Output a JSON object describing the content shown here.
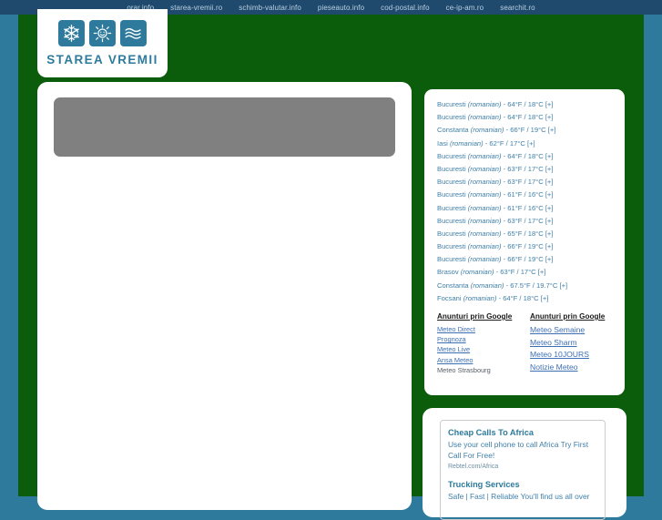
{
  "topnav": {
    "links": [
      {
        "label": "orar.info"
      },
      {
        "label": "starea-vremii.ro"
      },
      {
        "label": "schimb-valutar.info"
      },
      {
        "label": "pieseauto.info"
      },
      {
        "label": "cod-postal.info"
      },
      {
        "label": "ce-ip-am.ro"
      },
      {
        "label": "searchit.ro"
      }
    ]
  },
  "logo": {
    "text": "STAREA VREMII",
    "icons": [
      "snowflake-icon",
      "sun-icon",
      "waves-icon"
    ]
  },
  "weather": {
    "rows": [
      {
        "city": "Bucuresti",
        "lang": "(romanian)",
        "temp": "- 64°F / 18°C",
        "expand": "[+]"
      },
      {
        "city": "Bucuresti",
        "lang": "(romanian)",
        "temp": "- 64°F / 18°C",
        "expand": "[+]"
      },
      {
        "city": "Constanta",
        "lang": "(romanian)",
        "temp": "- 66°F / 19°C",
        "expand": "[+]"
      },
      {
        "city": "Iasi",
        "lang": "(romanian)",
        "temp": "- 62°F / 17°C",
        "expand": "[+]"
      },
      {
        "city": "Bucuresti",
        "lang": "(romanian)",
        "temp": "- 64°F / 18°C",
        "expand": "[+]"
      },
      {
        "city": "Bucuresti",
        "lang": "(romanian)",
        "temp": "- 63°F / 17°C",
        "expand": "[+]"
      },
      {
        "city": "Bucuresti",
        "lang": "(romanian)",
        "temp": "- 63°F / 17°C",
        "expand": "[+]"
      },
      {
        "city": "Bucuresti",
        "lang": "(romanian)",
        "temp": "- 61°F / 16°C",
        "expand": "[+]"
      },
      {
        "city": "Bucuresti",
        "lang": "(romanian)",
        "temp": "- 61°F / 16°C",
        "expand": "[+]"
      },
      {
        "city": "Bucuresti",
        "lang": "(romanian)",
        "temp": "- 63°F / 17°C",
        "expand": "[+]"
      },
      {
        "city": "Bucuresti",
        "lang": "(romanian)",
        "temp": "- 65°F / 18°C",
        "expand": "[+]"
      },
      {
        "city": "Bucuresti",
        "lang": "(romanian)",
        "temp": "- 66°F / 19°C",
        "expand": "[+]"
      },
      {
        "city": "Bucuresti",
        "lang": "(romanian)",
        "temp": "- 66°F / 19°C",
        "expand": "[+]"
      },
      {
        "city": "Brasov",
        "lang": "(romanian)",
        "temp": "- 63°F / 17°C",
        "expand": "[+]"
      },
      {
        "city": "Constanta",
        "lang": "(romanian)",
        "temp": "- 67.5°F / 19.7°C",
        "expand": "[+]"
      },
      {
        "city": "Focsani",
        "lang": "(romanian)",
        "temp": "- 64°F / 18°C",
        "expand": "[+]"
      }
    ]
  },
  "google_ads": {
    "left": {
      "heading": "Anunturi prin Google",
      "links": [
        {
          "label": "Meteo Direct",
          "style": "link"
        },
        {
          "label": "Prognoza",
          "style": "link"
        },
        {
          "label": "Meteo Live",
          "style": "link"
        },
        {
          "label": "Ansa Meteo",
          "style": "link"
        },
        {
          "label": "Meteo Strasbourg",
          "style": "plain"
        }
      ]
    },
    "right": {
      "heading": "Anunturi prin Google",
      "links": [
        {
          "label": "Meteo Semaine"
        },
        {
          "label": "Meteo Sharm"
        },
        {
          "label": "Meteo 10JOURS"
        },
        {
          "label": "Notizie Meteo"
        }
      ]
    }
  },
  "bottom_ads": [
    {
      "title": "Cheap Calls To Africa",
      "body": "Use your cell phone to call Africa Try First Call For Free!",
      "url": "Rebtel.com/Africa"
    },
    {
      "title": "Trucking Services",
      "body": "Safe | Fast | Reliable You'll find us all over",
      "url": ""
    }
  ],
  "colors": {
    "topbar": "#1f4a6e",
    "page_side": "#2d7a9c",
    "green": "#0b5c0b",
    "brand": "#2d7a9c",
    "weather_text": "#3f7fa8",
    "link": "#3d6fb5",
    "placeholder": "#808080"
  }
}
